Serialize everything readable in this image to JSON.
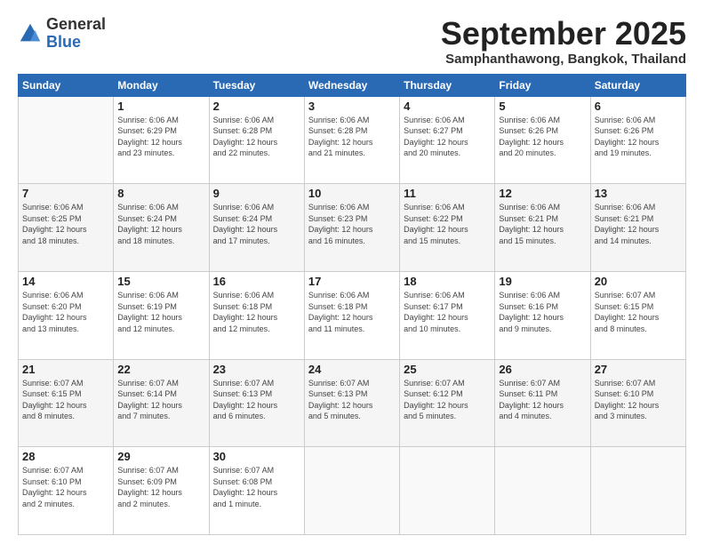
{
  "header": {
    "logo_general": "General",
    "logo_blue": "Blue",
    "month_title": "September 2025",
    "location": "Samphanthawong, Bangkok, Thailand"
  },
  "weekdays": [
    "Sunday",
    "Monday",
    "Tuesday",
    "Wednesday",
    "Thursday",
    "Friday",
    "Saturday"
  ],
  "weeks": [
    [
      {
        "day": "",
        "info": ""
      },
      {
        "day": "1",
        "info": "Sunrise: 6:06 AM\nSunset: 6:29 PM\nDaylight: 12 hours\nand 23 minutes."
      },
      {
        "day": "2",
        "info": "Sunrise: 6:06 AM\nSunset: 6:28 PM\nDaylight: 12 hours\nand 22 minutes."
      },
      {
        "day": "3",
        "info": "Sunrise: 6:06 AM\nSunset: 6:28 PM\nDaylight: 12 hours\nand 21 minutes."
      },
      {
        "day": "4",
        "info": "Sunrise: 6:06 AM\nSunset: 6:27 PM\nDaylight: 12 hours\nand 20 minutes."
      },
      {
        "day": "5",
        "info": "Sunrise: 6:06 AM\nSunset: 6:26 PM\nDaylight: 12 hours\nand 20 minutes."
      },
      {
        "day": "6",
        "info": "Sunrise: 6:06 AM\nSunset: 6:26 PM\nDaylight: 12 hours\nand 19 minutes."
      }
    ],
    [
      {
        "day": "7",
        "info": "Sunrise: 6:06 AM\nSunset: 6:25 PM\nDaylight: 12 hours\nand 18 minutes."
      },
      {
        "day": "8",
        "info": "Sunrise: 6:06 AM\nSunset: 6:24 PM\nDaylight: 12 hours\nand 18 minutes."
      },
      {
        "day": "9",
        "info": "Sunrise: 6:06 AM\nSunset: 6:24 PM\nDaylight: 12 hours\nand 17 minutes."
      },
      {
        "day": "10",
        "info": "Sunrise: 6:06 AM\nSunset: 6:23 PM\nDaylight: 12 hours\nand 16 minutes."
      },
      {
        "day": "11",
        "info": "Sunrise: 6:06 AM\nSunset: 6:22 PM\nDaylight: 12 hours\nand 15 minutes."
      },
      {
        "day": "12",
        "info": "Sunrise: 6:06 AM\nSunset: 6:21 PM\nDaylight: 12 hours\nand 15 minutes."
      },
      {
        "day": "13",
        "info": "Sunrise: 6:06 AM\nSunset: 6:21 PM\nDaylight: 12 hours\nand 14 minutes."
      }
    ],
    [
      {
        "day": "14",
        "info": "Sunrise: 6:06 AM\nSunset: 6:20 PM\nDaylight: 12 hours\nand 13 minutes."
      },
      {
        "day": "15",
        "info": "Sunrise: 6:06 AM\nSunset: 6:19 PM\nDaylight: 12 hours\nand 12 minutes."
      },
      {
        "day": "16",
        "info": "Sunrise: 6:06 AM\nSunset: 6:18 PM\nDaylight: 12 hours\nand 12 minutes."
      },
      {
        "day": "17",
        "info": "Sunrise: 6:06 AM\nSunset: 6:18 PM\nDaylight: 12 hours\nand 11 minutes."
      },
      {
        "day": "18",
        "info": "Sunrise: 6:06 AM\nSunset: 6:17 PM\nDaylight: 12 hours\nand 10 minutes."
      },
      {
        "day": "19",
        "info": "Sunrise: 6:06 AM\nSunset: 6:16 PM\nDaylight: 12 hours\nand 9 minutes."
      },
      {
        "day": "20",
        "info": "Sunrise: 6:07 AM\nSunset: 6:15 PM\nDaylight: 12 hours\nand 8 minutes."
      }
    ],
    [
      {
        "day": "21",
        "info": "Sunrise: 6:07 AM\nSunset: 6:15 PM\nDaylight: 12 hours\nand 8 minutes."
      },
      {
        "day": "22",
        "info": "Sunrise: 6:07 AM\nSunset: 6:14 PM\nDaylight: 12 hours\nand 7 minutes."
      },
      {
        "day": "23",
        "info": "Sunrise: 6:07 AM\nSunset: 6:13 PM\nDaylight: 12 hours\nand 6 minutes."
      },
      {
        "day": "24",
        "info": "Sunrise: 6:07 AM\nSunset: 6:13 PM\nDaylight: 12 hours\nand 5 minutes."
      },
      {
        "day": "25",
        "info": "Sunrise: 6:07 AM\nSunset: 6:12 PM\nDaylight: 12 hours\nand 5 minutes."
      },
      {
        "day": "26",
        "info": "Sunrise: 6:07 AM\nSunset: 6:11 PM\nDaylight: 12 hours\nand 4 minutes."
      },
      {
        "day": "27",
        "info": "Sunrise: 6:07 AM\nSunset: 6:10 PM\nDaylight: 12 hours\nand 3 minutes."
      }
    ],
    [
      {
        "day": "28",
        "info": "Sunrise: 6:07 AM\nSunset: 6:10 PM\nDaylight: 12 hours\nand 2 minutes."
      },
      {
        "day": "29",
        "info": "Sunrise: 6:07 AM\nSunset: 6:09 PM\nDaylight: 12 hours\nand 2 minutes."
      },
      {
        "day": "30",
        "info": "Sunrise: 6:07 AM\nSunset: 6:08 PM\nDaylight: 12 hours\nand 1 minute."
      },
      {
        "day": "",
        "info": ""
      },
      {
        "day": "",
        "info": ""
      },
      {
        "day": "",
        "info": ""
      },
      {
        "day": "",
        "info": ""
      }
    ]
  ]
}
